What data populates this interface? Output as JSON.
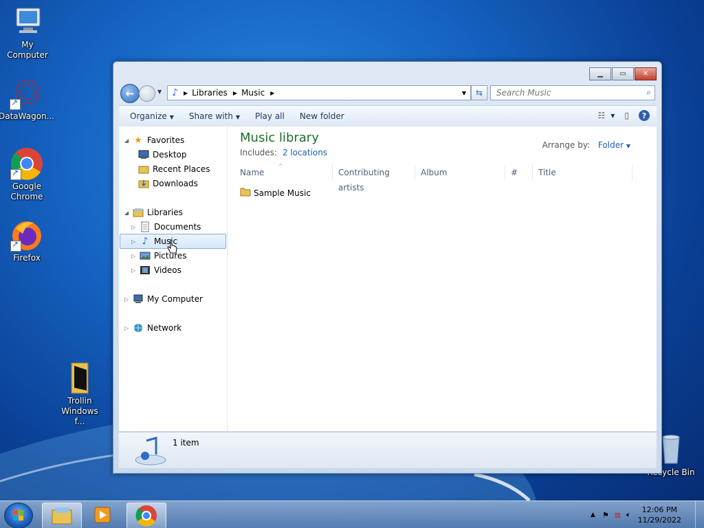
{
  "desktop": {
    "icons": [
      {
        "label": "My Computer"
      },
      {
        "label": "DataWagon..."
      },
      {
        "label": "Google Chrome"
      },
      {
        "label": "Firefox"
      },
      {
        "label": "Trollin Windows f..."
      },
      {
        "label": "Recycle Bin"
      }
    ]
  },
  "window": {
    "address": {
      "crumbs": [
        "Libraries",
        "Music"
      ]
    },
    "search": {
      "placeholder": "Search Music"
    },
    "toolbar": {
      "organize": "Organize",
      "share_with": "Share with",
      "play_all": "Play all",
      "new_folder": "New folder"
    },
    "nav": {
      "favorites": "Favorites",
      "desktop": "Desktop",
      "recent_places": "Recent Places",
      "downloads": "Downloads",
      "libraries": "Libraries",
      "documents": "Documents",
      "music": "Music",
      "pictures": "Pictures",
      "videos": "Videos",
      "my_computer": "My Computer",
      "network": "Network"
    },
    "library": {
      "title": "Music library",
      "includes_label": "Includes:",
      "includes_link": "2 locations",
      "arrange_label": "Arrange by:",
      "arrange_value": "Folder"
    },
    "columns": [
      "Name",
      "Contributing artists",
      "Album",
      "#",
      "Title"
    ],
    "files": [
      {
        "name": "Sample Music"
      }
    ],
    "details": {
      "count": "1 item"
    }
  },
  "taskbar": {
    "time": "12:06 PM",
    "date": "11/29/2022"
  },
  "colors": {
    "accent": "#1e6e2c",
    "link": "#1a5fb4"
  }
}
